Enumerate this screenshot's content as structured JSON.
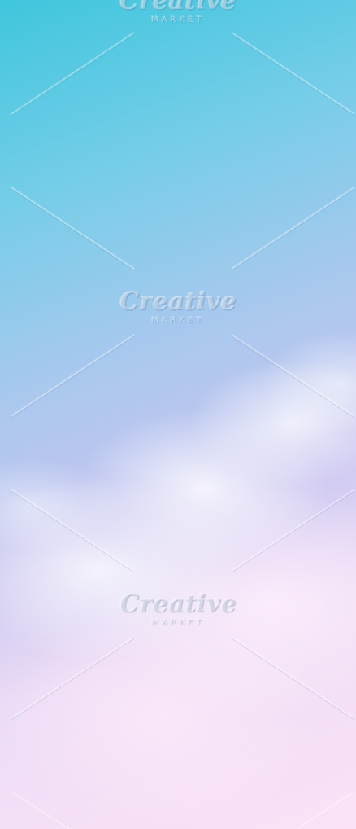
{
  "background": {
    "colors": [
      "#3fc6dd",
      "#a9c8ee",
      "#c6c4f0",
      "#fbe2f6"
    ]
  },
  "watermark": {
    "logo": "Creative",
    "sub": "MARKET"
  }
}
